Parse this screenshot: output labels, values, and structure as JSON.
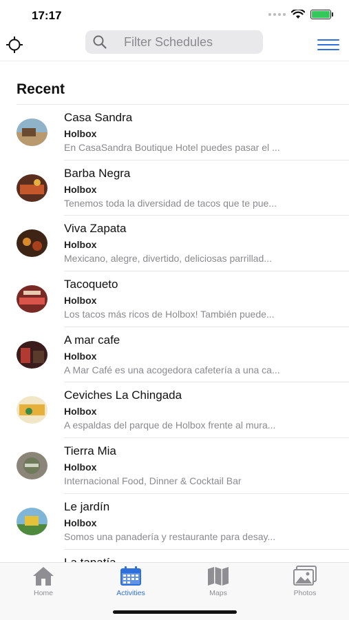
{
  "status_bar": {
    "time": "17:17"
  },
  "search": {
    "placeholder": "Filter Schedules"
  },
  "section": {
    "title": "Recent"
  },
  "items": [
    {
      "title": "Casa Sandra",
      "location": "Holbox",
      "description": "En CasaSandra Boutique Hotel puedes pasar el ..."
    },
    {
      "title": "Barba Negra",
      "location": "Holbox",
      "description": "Tenemos toda la diversidad de tacos que te pue..."
    },
    {
      "title": "Viva Zapata",
      "location": "Holbox",
      "description": "Mexicano, alegre, divertido, deliciosas parrillad..."
    },
    {
      "title": "Tacoqueto",
      "location": "Holbox",
      "description": "Los tacos más ricos de Holbox! También puede..."
    },
    {
      "title": "A mar cafe",
      "location": "Holbox",
      "description": "A Mar Café es una acogedora cafetería a una ca..."
    },
    {
      "title": "Ceviches La Chingada",
      "location": "Holbox",
      "description": "A espaldas del parque de Holbox frente al mura..."
    },
    {
      "title": "Tierra Mia",
      "location": "Holbox",
      "description": "Internacional Food, Dinner & Cocktail Bar"
    },
    {
      "title": "Le jardín",
      "location": "Holbox",
      "description": "Somos una panadería y restaurante para desay..."
    },
    {
      "title": "La tapatía",
      "location": "",
      "description": ""
    }
  ],
  "tabs": [
    {
      "label": "Home",
      "icon": "home-icon",
      "active": false
    },
    {
      "label": "Activities",
      "icon": "calendar-icon",
      "active": true
    },
    {
      "label": "Maps",
      "icon": "map-icon",
      "active": false
    },
    {
      "label": "Photos",
      "icon": "photos-icon",
      "active": false
    }
  ],
  "colors": {
    "accent": "#2f6fdc",
    "inactive": "#8e8e93"
  }
}
